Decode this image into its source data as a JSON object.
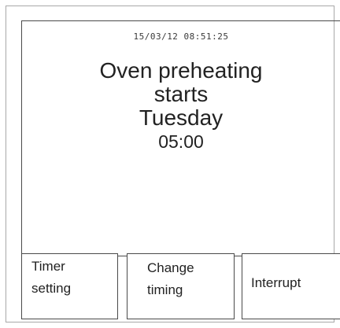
{
  "display": {
    "datetime": "15/03/12  08:51:25",
    "message": {
      "line1": "Oven preheating",
      "line2": "starts",
      "line3": "Tuesday",
      "line4": "05:00"
    }
  },
  "softkeys": [
    {
      "label": "Timer\nsetting"
    },
    {
      "label": "Change\ntiming"
    },
    {
      "label": "Interrupt"
    }
  ]
}
